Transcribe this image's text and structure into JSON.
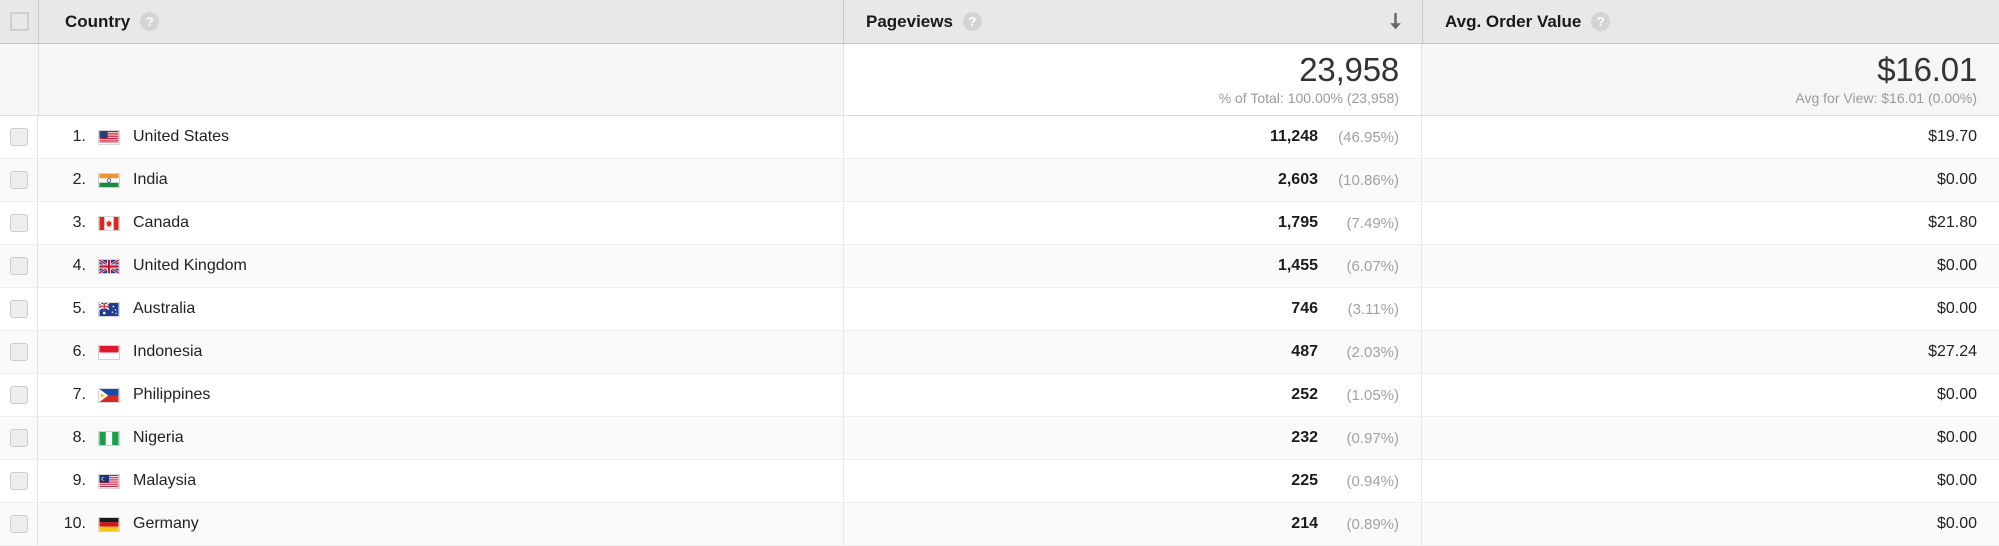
{
  "table": {
    "columns": {
      "select_all": "",
      "country": "Country",
      "pageviews": "Pageviews",
      "avg_order_value": "Avg. Order Value",
      "help_glyph": "?",
      "sort_icon": "sort-descending-arrow-icon",
      "sorted_by": "Pageviews",
      "sort_direction": "descending"
    },
    "summary": {
      "pageviews_value": "23,958",
      "pageviews_note": "% of Total: 100.00% (23,958)",
      "aov_value": "$16.01",
      "aov_note": "Avg for View: $16.01 (0.00%)"
    },
    "rows": [
      {
        "rank": "1.",
        "flag": "us",
        "country": "United States",
        "pageviews": "11,248",
        "pageviews_pct": "(46.95%)",
        "aov": "$19.70"
      },
      {
        "rank": "2.",
        "flag": "in",
        "country": "India",
        "pageviews": "2,603",
        "pageviews_pct": "(10.86%)",
        "aov": "$0.00"
      },
      {
        "rank": "3.",
        "flag": "ca",
        "country": "Canada",
        "pageviews": "1,795",
        "pageviews_pct": "(7.49%)",
        "aov": "$21.80"
      },
      {
        "rank": "4.",
        "flag": "gb",
        "country": "United Kingdom",
        "pageviews": "1,455",
        "pageviews_pct": "(6.07%)",
        "aov": "$0.00"
      },
      {
        "rank": "5.",
        "flag": "au",
        "country": "Australia",
        "pageviews": "746",
        "pageviews_pct": "(3.11%)",
        "aov": "$0.00"
      },
      {
        "rank": "6.",
        "flag": "id",
        "country": "Indonesia",
        "pageviews": "487",
        "pageviews_pct": "(2.03%)",
        "aov": "$27.24"
      },
      {
        "rank": "7.",
        "flag": "ph",
        "country": "Philippines",
        "pageviews": "252",
        "pageviews_pct": "(1.05%)",
        "aov": "$0.00"
      },
      {
        "rank": "8.",
        "flag": "ng",
        "country": "Nigeria",
        "pageviews": "232",
        "pageviews_pct": "(0.97%)",
        "aov": "$0.00"
      },
      {
        "rank": "9.",
        "flag": "my",
        "country": "Malaysia",
        "pageviews": "225",
        "pageviews_pct": "(0.94%)",
        "aov": "$0.00"
      },
      {
        "rank": "10.",
        "flag": "de",
        "country": "Germany",
        "pageviews": "214",
        "pageviews_pct": "(0.89%)",
        "aov": "$0.00"
      }
    ]
  },
  "colors": {
    "header_bg": "#e8e8e8",
    "summary_bg": "#f6f6f6",
    "row_alt_bg": "#fafafa",
    "text": "#222222",
    "muted_text": "#a2a2a2",
    "border": "#e7e7e7"
  }
}
